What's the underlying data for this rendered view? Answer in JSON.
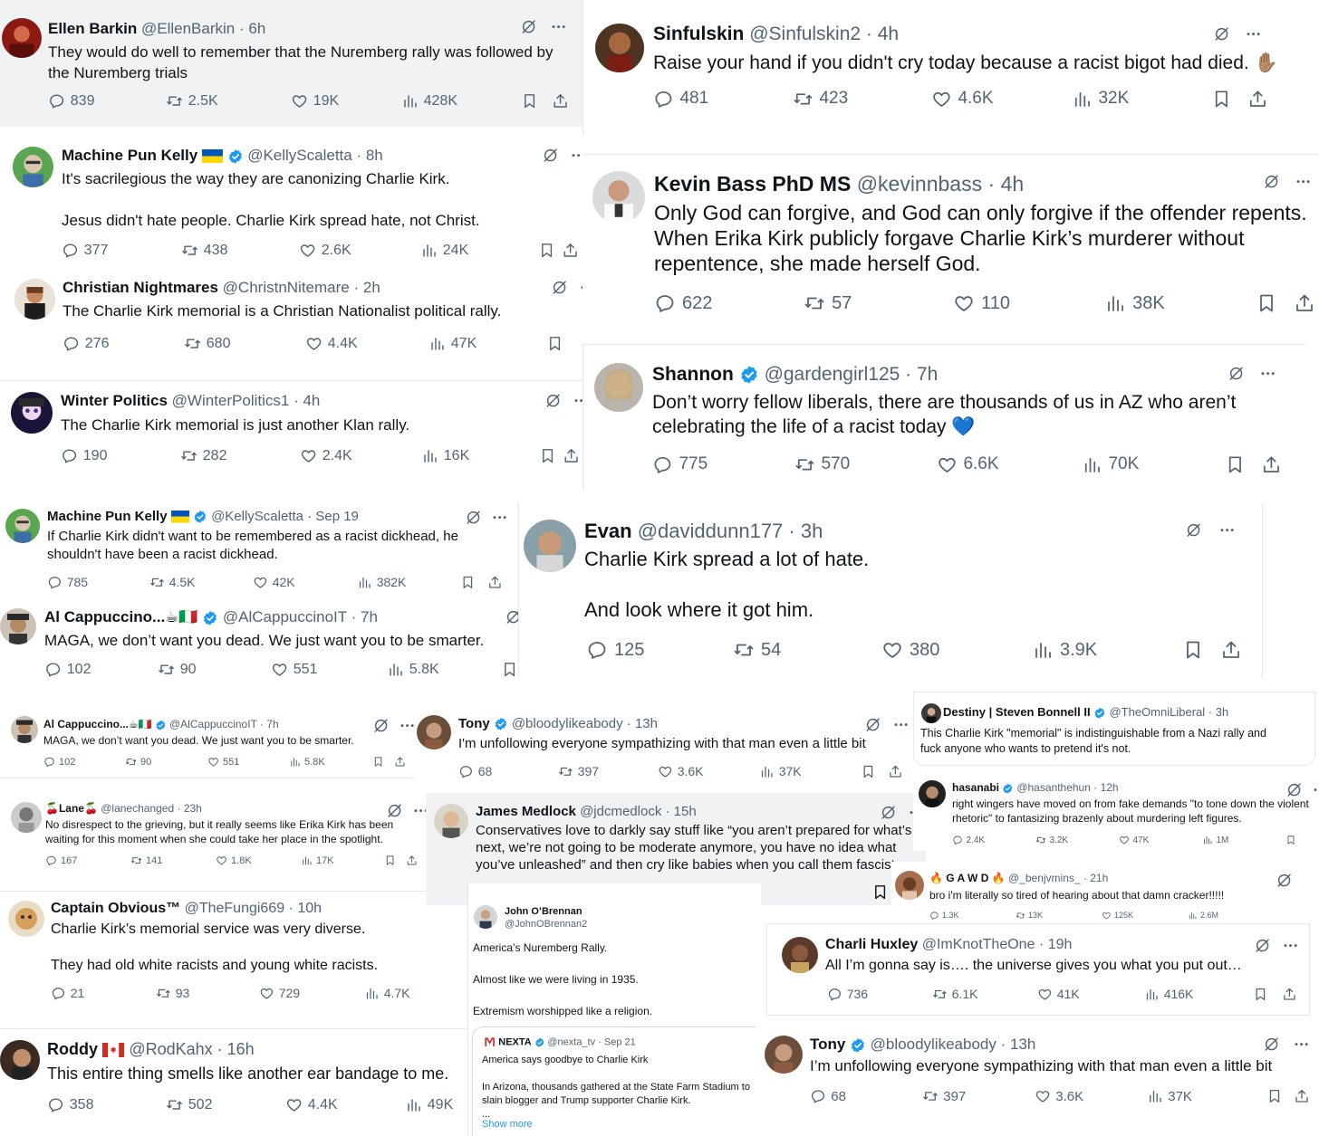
{
  "colors": {
    "verified": "#1d9bf0",
    "muted": "#536471",
    "text": "#0f1419",
    "gray_bg": "#f1f2f3"
  },
  "tweets": [
    {
      "name": "Ellen Barkin",
      "handle": "@EllenBarkin",
      "time": "6h",
      "text": "They would do well to remember that the Nuremberg rally was followed by\nthe Nuremberg trials",
      "replies": "839",
      "reposts": "2.5K",
      "likes": "19K",
      "views": "428K"
    },
    {
      "name": "Machine Pun Kelly",
      "handle": "@KellyScaletta",
      "time": "8h",
      "text": "It's sacrilegious the way they are canonizing Charlie Kirk.\n\nJesus didn't hate people. Charlie Kirk spread hate, not Christ.",
      "replies": "377",
      "reposts": "438",
      "likes": "2.6K",
      "views": "24K"
    },
    {
      "name": "Christian Nightmares",
      "handle": "@ChristnNitemare",
      "time": "2h",
      "text": "The Charlie Kirk memorial is a Christian Nationalist political rally.",
      "replies": "276",
      "reposts": "680",
      "likes": "4.4K",
      "views": "47K"
    },
    {
      "name": "Winter Politics",
      "handle": "@WinterPolitics1",
      "time": "4h",
      "text": "The Charlie Kirk memorial is just another Klan rally.",
      "replies": "190",
      "reposts": "282",
      "likes": "2.4K",
      "views": "16K"
    },
    {
      "name": "Machine Pun Kelly",
      "handle": "@KellyScaletta",
      "time": "Sep 19",
      "text": "If Charlie Kirk didn't want to be remembered as a racist dickhead, he\nshouldn't have been a racist dickhead.",
      "replies": "785",
      "reposts": "4.5K",
      "likes": "42K",
      "views": "382K"
    },
    {
      "name": "Al Cappuccino...☕🇮🇹",
      "handle": "@AlCappuccinoIT",
      "time": "7h",
      "text": "MAGA, we don’t want you dead. We just want you to be smarter.",
      "replies": "102",
      "reposts": "90",
      "likes": "551",
      "views": "5.8K"
    },
    {
      "name": "Al Cappuccino...☕🇮🇹",
      "handle": "@AlCappuccinoIT",
      "time": "7h",
      "text": "MAGA, we don’t want you dead. We just want you to be smarter.",
      "replies": "102",
      "reposts": "90",
      "likes": "551",
      "views": "5.8K"
    },
    {
      "name": "🍒Lane🍒",
      "handle": "@lanechanged",
      "time": "23h",
      "text": "No disrespect to the grieving, but it really seems like Erika Kirk has been\nwaiting for this moment when she could take her place in the spotlight.",
      "replies": "167",
      "reposts": "141",
      "likes": "1.8K",
      "views": "17K"
    },
    {
      "name": "Captain Obvious™",
      "handle": "@TheFungi669",
      "time": "10h",
      "text": "Charlie Kirk’s memorial service was very diverse.\n\nThey had old white racists and young white racists.",
      "replies": "21",
      "reposts": "93",
      "likes": "729",
      "views": "4.7K"
    },
    {
      "name": "Roddy",
      "handle": "@RodKahx",
      "time": "16h",
      "text": "This entire thing smells like another ear bandage to me.",
      "replies": "358",
      "reposts": "502",
      "likes": "4.4K",
      "views": "49K"
    },
    {
      "name": "Sinfulskin",
      "handle": "@Sinfulskin2",
      "time": "4h",
      "text": "Raise your hand if you didn't cry today because a racist bigot had died. ✋🏽",
      "replies": "481",
      "reposts": "423",
      "likes": "4.6K",
      "views": "32K"
    },
    {
      "name": "Kevin Bass PhD MS",
      "handle": "@kevinnbass",
      "time": "4h",
      "text": "Only God can forgive, and God can only forgive if the offender repents.\nWhen Erika Kirk publicly forgave Charlie Kirk’s murderer without\nrepentence, she made herself God.",
      "replies": "622",
      "reposts": "57",
      "likes": "110",
      "views": "38K"
    },
    {
      "name": "Shannon",
      "handle": "@gardengirl125",
      "time": "7h",
      "text": "Don’t worry fellow liberals, there are thousands of us in AZ who aren’t\ncelebrating the life of a racist today 💙",
      "replies": "775",
      "reposts": "570",
      "likes": "6.6K",
      "views": "70K"
    },
    {
      "name": "Evan",
      "handle": "@daviddunn177",
      "time": "3h",
      "text": "Charlie Kirk spread a lot of hate.\n\nAnd look where it got him.",
      "replies": "125",
      "reposts": "54",
      "likes": "380",
      "views": "3.9K"
    },
    {
      "name": "Tony",
      "handle": "@bloodylikeabody",
      "time": "13h",
      "text": "I'm unfollowing everyone sympathizing with that man even a little bit",
      "replies": "68",
      "reposts": "397",
      "likes": "3.6K",
      "views": "37K"
    },
    {
      "name": "James Medlock",
      "handle": "@jdcmedlock",
      "time": "15h",
      "text": "Conservatives love to darkly say stuff like “you aren’t prepared for what’s\nnext, we’re not going to be moderate anymore, you have no idea what\nyou’ve unleashed” and then cry like babies when you call them fascists",
      "replies": "",
      "reposts": "",
      "likes": "",
      "views": ""
    },
    {
      "name": "John O’Brennan",
      "handle": "@JohnOBrennan2",
      "time": "",
      "text": "America’s Nuremberg Rally.\n\nAlmost like we were living in 1935.\n\nExtremism worshipped like a religion.",
      "replies": "",
      "reposts": "",
      "likes": "",
      "views": ""
    },
    {
      "name": "Destiny | Steven Bonnell II",
      "handle": "@TheOmniLiberal",
      "time": "3h",
      "text": "This Charlie Kirk \"memorial\" is indistinguishable from a Nazi rally and\nfuck anyone who wants to pretend it's not.",
      "replies": "",
      "reposts": "",
      "likes": "",
      "views": ""
    },
    {
      "name": "hasanabi",
      "handle": "@hasanthehun",
      "time": "12h",
      "text": "right wingers have moved on from fake demands \"to tone down the violent\nrhetoric\" to fantasizing brazenly about murdering left figures.",
      "replies": "2.4K",
      "reposts": "3.2K",
      "likes": "47K",
      "views": "1M"
    },
    {
      "name": "🔥 G A W D 🔥",
      "handle": "@_benjvmins_",
      "time": "21h",
      "text": "bro i'm literally so tired of hearing about that damn cracker!!!!!",
      "replies": "1.3K",
      "reposts": "13K",
      "likes": "125K",
      "views": "2.6M"
    },
    {
      "name": "Charli Huxley",
      "handle": "@ImKnotTheOne",
      "time": "19h",
      "text": "All I’m gonna say is…. the universe gives you what you put out…",
      "replies": "736",
      "reposts": "6.1K",
      "likes": "41K",
      "views": "416K"
    },
    {
      "name": "Tony",
      "handle": "@bloodylikeabody",
      "time": "13h",
      "text": "I’m unfollowing everyone sympathizing with that man even a little bit",
      "replies": "68",
      "reposts": "397",
      "likes": "3.6K",
      "views": "37K"
    }
  ],
  "quote": {
    "name": "NEXTA",
    "handle": "@nexta_tv",
    "time": "Sep 21",
    "text": "America says goodbye to Charlie Kirk\n\nIn Arizona, thousands gathered at the State Farm Stadium to\nslain blogger and Trump supporter Charlie Kirk.\n...",
    "show_more": "Show more"
  }
}
